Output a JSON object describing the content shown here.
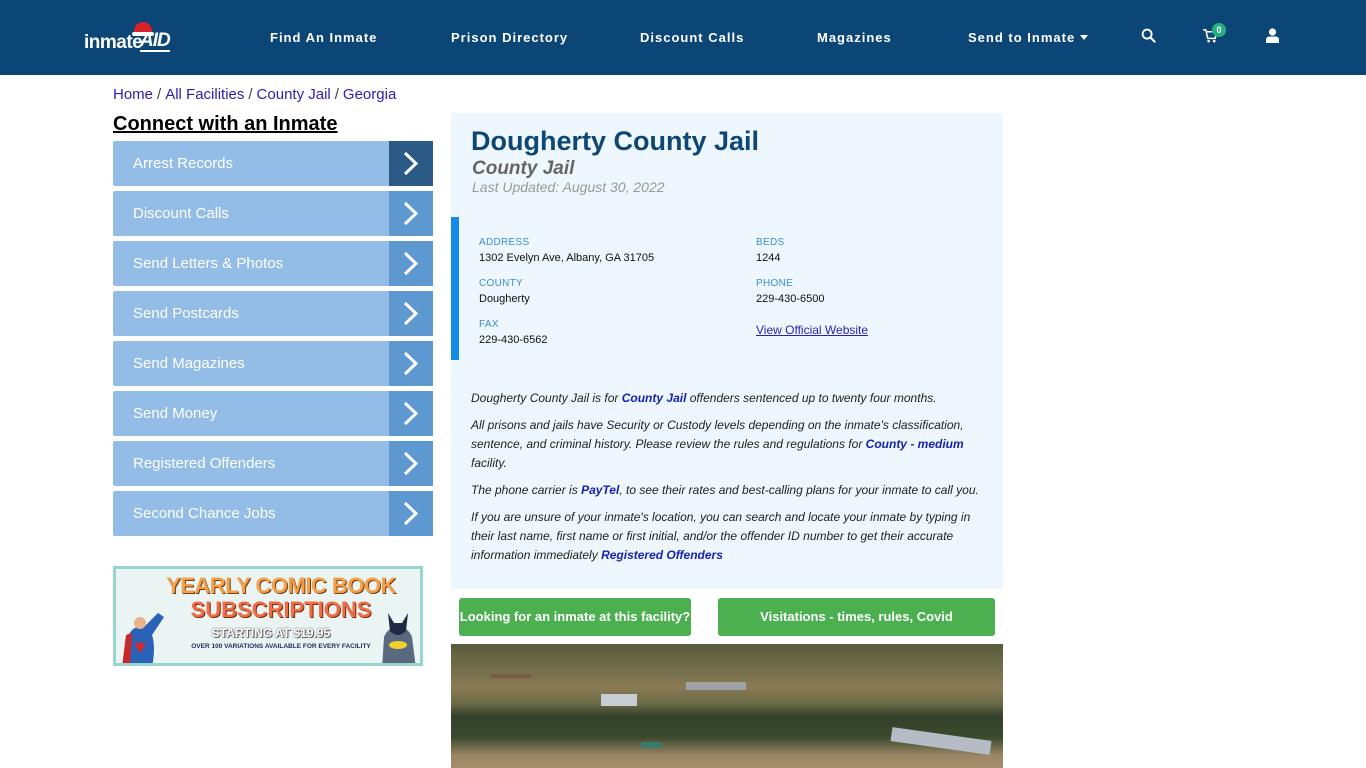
{
  "header": {
    "logo": {
      "part1": "inmate",
      "part2": "AID"
    },
    "nav": [
      {
        "label": "Find An Inmate"
      },
      {
        "label": "Prison Directory"
      },
      {
        "label": "Discount Calls"
      },
      {
        "label": "Magazines"
      },
      {
        "label": "Send to Inmate",
        "has_dropdown": true
      }
    ],
    "icons": {
      "search": "search-icon",
      "cart": "cart-icon",
      "user": "user-icon"
    },
    "cart_count": "0"
  },
  "breadcrumb": [
    {
      "label": "Home"
    },
    {
      "label": "All Facilities"
    },
    {
      "label": "County Jail"
    },
    {
      "label": "Georgia"
    }
  ],
  "sidebar": {
    "title": "Connect with an Inmate",
    "items": [
      {
        "label": "Arrest Records"
      },
      {
        "label": "Discount Calls"
      },
      {
        "label": "Send Letters & Photos"
      },
      {
        "label": "Send Postcards"
      },
      {
        "label": "Send Magazines"
      },
      {
        "label": "Send Money"
      },
      {
        "label": "Registered Offenders"
      },
      {
        "label": "Second Chance Jobs"
      }
    ],
    "ad": {
      "line1": "YEARLY COMIC BOOK",
      "line2": "SUBSCRIPTIONS",
      "line3": "STARTING AT $19.95",
      "line4": "OVER 100 VARIATIONS AVAILABLE FOR EVERY FACILITY"
    }
  },
  "facility": {
    "name": "Dougherty County Jail",
    "type": "County Jail",
    "last_updated": "Last Updated: August 30, 2022",
    "fields": {
      "address": {
        "label": "ADDRESS",
        "value": "1302 Evelyn Ave, Albany, GA 31705"
      },
      "beds": {
        "label": "BEDS",
        "value": "1244"
      },
      "county": {
        "label": "COUNTY",
        "value": "Dougherty"
      },
      "phone": {
        "label": "PHONE",
        "value": "229-430-6500"
      },
      "fax": {
        "label": "FAX",
        "value": "229-430-6562"
      },
      "website_link": "View Official Website"
    },
    "description": {
      "p1": {
        "pre": "Dougherty County Jail is for ",
        "link": "County Jail",
        "post": " offenders sentenced up to twenty four months."
      },
      "p2": {
        "pre": "All prisons and jails have Security or Custody levels depending on the inmate's classification, sentence, and criminal history. Please review the rules and regulations for ",
        "link": "County - medium",
        "post": " facility."
      },
      "p3": {
        "pre": "The phone carrier is ",
        "link": "PayTel",
        "post": ", to see their rates and best-calling plans for your inmate to call you."
      },
      "p4": {
        "pre": "If you are unsure of your inmate's location, you can search and locate your inmate by typing in their last name, first name or first initial, and/or the offender ID number to get their accurate information immediately ",
        "link": "Registered Offenders",
        "post": ""
      }
    }
  },
  "buttons": {
    "find_inmate": "Looking for an inmate at this facility?",
    "visitations": "Visitations - times, rules, Covid cancellations"
  },
  "colors": {
    "header_bg": "#0b4677",
    "accent_green": "#4caf50",
    "sidebar_item": "#93bde6",
    "panel_bg": "#edf7fd",
    "info_bar": "#128be6"
  }
}
